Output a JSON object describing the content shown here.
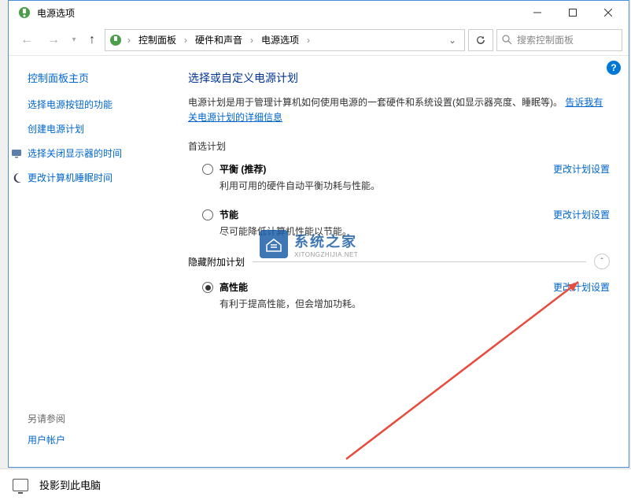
{
  "titlebar": {
    "title": "电源选项"
  },
  "nav": {
    "crumbs": [
      "控制面板",
      "硬件和声音",
      "电源选项"
    ],
    "search_placeholder": "搜索控制面板"
  },
  "sidebar": {
    "home": "控制面板主页",
    "links": [
      {
        "label": "选择电源按钮的功能",
        "icon": ""
      },
      {
        "label": "创建电源计划",
        "icon": ""
      },
      {
        "label": "选择关闭显示器的时间",
        "icon": "monitor"
      },
      {
        "label": "更改计算机睡眠时间",
        "icon": "moon"
      }
    ],
    "see_also": "另请参阅",
    "accounts": "用户帐户"
  },
  "main": {
    "heading": "选择或自定义电源计划",
    "desc_text": "电源计划是用于管理计算机如何使用电源的一套硬件和系统设置(如显示器亮度、睡眠等)。",
    "desc_link": "告诉我有关电源计划的详细信息",
    "section1": "首选计划",
    "section2": "隐藏附加计划",
    "plans": [
      {
        "name": "平衡 (推荐)",
        "desc": "利用可用的硬件自动平衡功耗与性能。",
        "change": "更改计划设置",
        "selected": false
      },
      {
        "name": "节能",
        "desc": "尽可能降低计算机性能以节能。",
        "change": "更改计划设置",
        "selected": false
      }
    ],
    "hidden_plans": [
      {
        "name": "高性能",
        "desc": "有利于提高性能，但会增加功耗。",
        "change": "更改计划设置",
        "selected": true
      }
    ]
  },
  "watermark": {
    "cn": "系统之家",
    "en": "XITONGZHIJIA.NET"
  },
  "taskbar": {
    "label": "投影到此电脑"
  }
}
